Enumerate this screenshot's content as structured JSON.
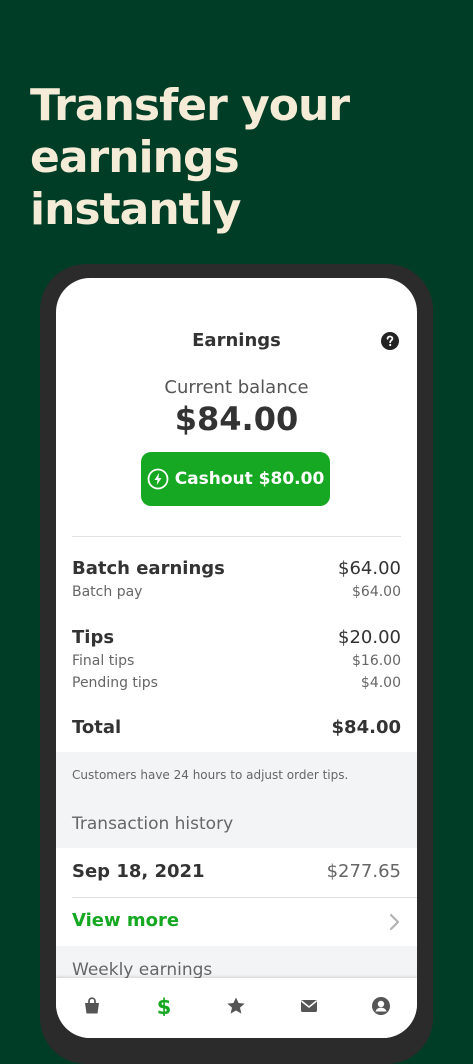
{
  "headline": "Transfer your earnings instantly",
  "screen": {
    "title": "Earnings",
    "balance_label": "Current balance",
    "balance_amount": "$84.00",
    "cashout_label": "Cashout $80.00"
  },
  "breakdown": {
    "batch": {
      "label": "Batch earnings",
      "value": "$64.00",
      "sub_label": "Batch pay",
      "sub_value": "$64.00"
    },
    "tips": {
      "label": "Tips",
      "value": "$20.00",
      "final_label": "Final tips",
      "final_value": "$16.00",
      "pending_label": "Pending tips",
      "pending_value": "$4.00"
    },
    "total": {
      "label": "Total",
      "value": "$84.00"
    }
  },
  "tips_note": "Customers have 24 hours to adjust order tips.",
  "transactions": {
    "header": "Transaction history",
    "items": [
      {
        "date": "Sep 18, 2021",
        "amount": "$277.65"
      }
    ],
    "view_more": "View more"
  },
  "weekly_header": "Weekly earnings",
  "tabbar": {
    "active_color": "#16a822",
    "inactive_color": "#555555",
    "items": [
      {
        "icon": "bag-icon"
      },
      {
        "icon": "dollar-icon"
      },
      {
        "icon": "star-icon"
      },
      {
        "icon": "mail-icon"
      },
      {
        "icon": "profile-icon"
      }
    ]
  },
  "colors": {
    "background": "#003d26",
    "headline": "#f4ecd6",
    "accent": "#16a822"
  }
}
